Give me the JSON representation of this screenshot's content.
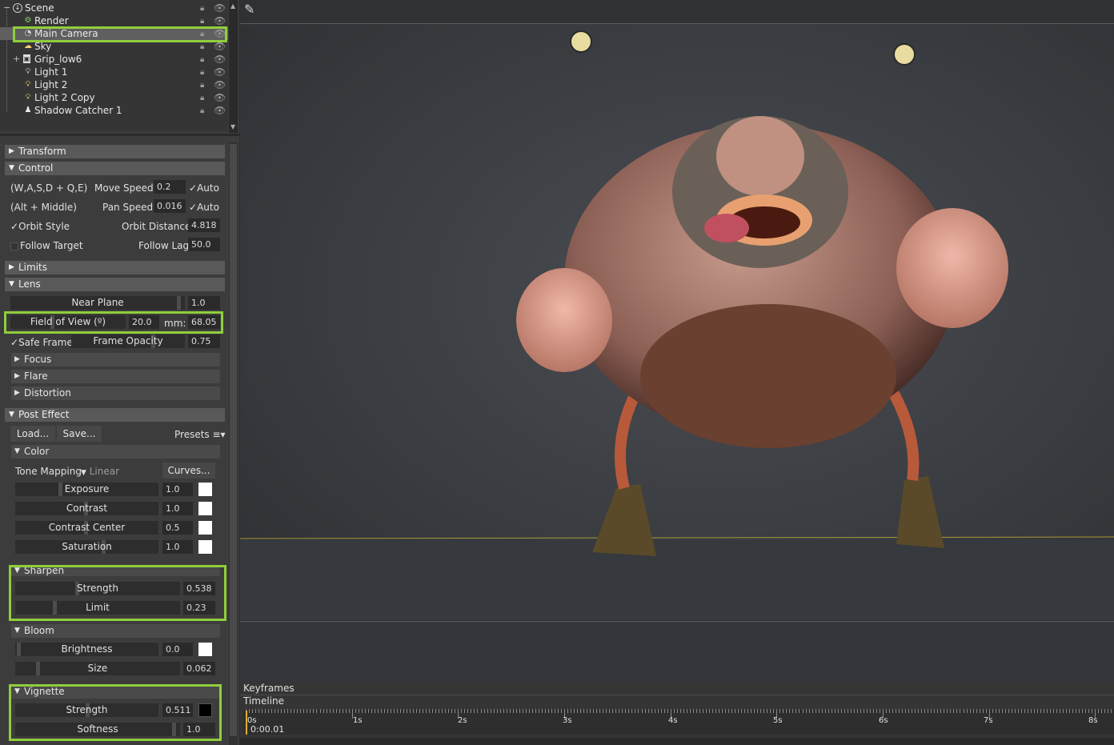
{
  "scene_tree": {
    "items": [
      {
        "label": "Scene",
        "icon": "scene-icon"
      },
      {
        "label": "Render",
        "icon": "render-gear-icon"
      },
      {
        "label": "Main Camera",
        "icon": "camera-icon"
      },
      {
        "label": "Sky",
        "icon": "sky-icon"
      },
      {
        "label": "Grip_low6",
        "icon": "mesh-icon"
      },
      {
        "label": "Light 1",
        "icon": "light-bulb-icon"
      },
      {
        "label": "Light 2",
        "icon": "light-bulb-icon"
      },
      {
        "label": "Light 2 Copy",
        "icon": "light-bulb-icon"
      },
      {
        "label": "Shadow Catcher 1",
        "icon": "shadow-catcher-icon"
      }
    ],
    "selected": "Main Camera"
  },
  "sections": {
    "transform": "Transform",
    "control": "Control",
    "limits": "Limits",
    "lens": "Lens",
    "post_effect": "Post Effect"
  },
  "control": {
    "keys1": "(W,A,S,D + Q,E)",
    "move_speed_label": "Move Speed:",
    "move_speed": "0.2",
    "auto1": "Auto",
    "keys2": "(Alt + Middle)",
    "pan_speed_label": "Pan Speed:",
    "pan_speed": "0.016",
    "auto2": "Auto",
    "orbit_style": "Orbit Style",
    "orbit_distance_label": "Orbit Distance:",
    "orbit_distance": "4.818",
    "follow_target": "Follow Target",
    "follow_lag_label": "Follow Lag",
    "follow_lag": "50.0"
  },
  "lens": {
    "near_plane_label": "Near Plane",
    "near_plane": "1.0",
    "fov_label": "Field of View (º)",
    "fov": "20.0",
    "mm_label": "mm:",
    "mm": "68.05",
    "safe_frame": "Safe Frame",
    "frame_opacity_label": "Frame Opacity",
    "frame_opacity": "0.75",
    "focus": "Focus",
    "flare": "Flare",
    "distortion": "Distortion"
  },
  "post_effect": {
    "load": "Load...",
    "save": "Save...",
    "presets": "Presets",
    "color": {
      "title": "Color",
      "tone_mapping_label": "Tone Mapping",
      "tone_mapping_value": "Linear",
      "curves": "Curves...",
      "exposure_label": "Exposure",
      "exposure": "1.0",
      "contrast_label": "Contrast",
      "contrast": "1.0",
      "contrast_center_label": "Contrast Center",
      "contrast_center": "0.5",
      "saturation_label": "Saturation",
      "saturation": "1.0"
    },
    "sharpen": {
      "title": "Sharpen",
      "strength_label": "Strength",
      "strength": "0.538",
      "limit_label": "Limit",
      "limit": "0.23"
    },
    "bloom": {
      "title": "Bloom",
      "brightness_label": "Brightness",
      "brightness": "0.0",
      "size_label": "Size",
      "size": "0.062"
    },
    "vignette": {
      "title": "Vignette",
      "strength_label": "Strength",
      "strength": "0.511",
      "softness_label": "Softness",
      "softness": "1.0"
    }
  },
  "timeline": {
    "keyframes_label": "Keyframes",
    "timeline_label": "Timeline",
    "current_time": "0:00.01",
    "ticks": [
      "0s",
      "1s",
      "2s",
      "3s",
      "4s",
      "5s",
      "6s",
      "7s",
      "8s"
    ]
  },
  "colors": {
    "highlight": "#8fce3d",
    "panel_bg": "#3c3c3c",
    "viewport_bg": "#393c40"
  }
}
